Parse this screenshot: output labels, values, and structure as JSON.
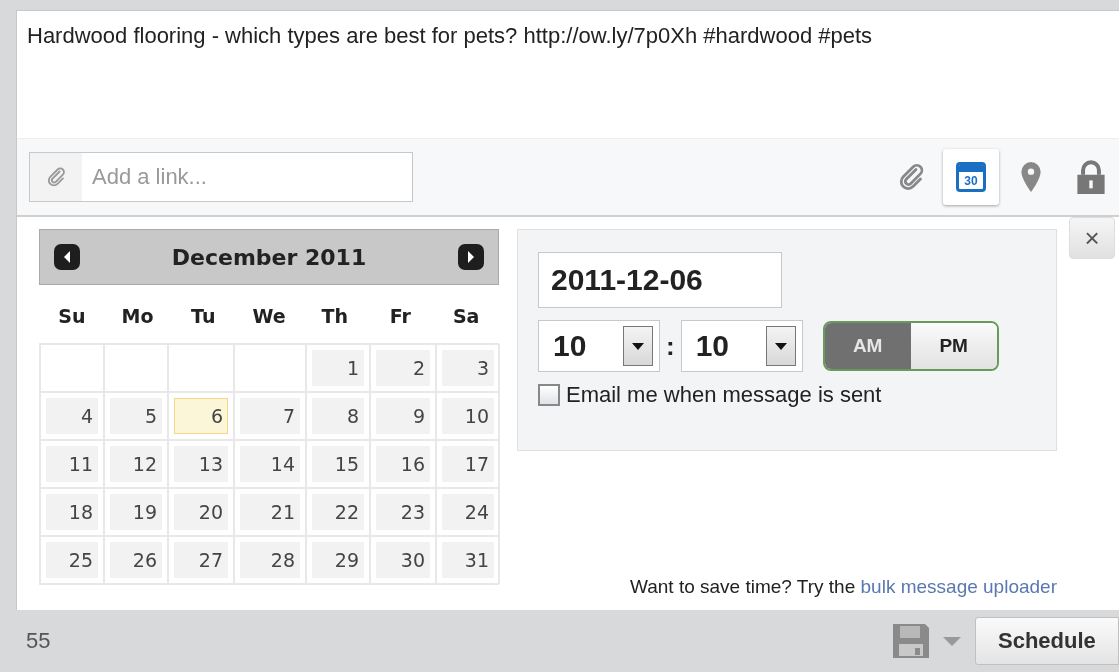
{
  "message": {
    "text": "Hardwood flooring - which types are best for pets? http://ow.ly/7p0Xh #hardwood #pets"
  },
  "link_field": {
    "placeholder": "Add a link..."
  },
  "tools": [
    {
      "kind": "attach",
      "selected": false
    },
    {
      "kind": "calendar",
      "selected": true,
      "label": "30"
    },
    {
      "kind": "location",
      "selected": false
    },
    {
      "kind": "lock",
      "selected": false
    }
  ],
  "calendar": {
    "title": "December 2011",
    "weekdays": [
      "Su",
      "Mo",
      "Tu",
      "We",
      "Th",
      "Fr",
      "Sa"
    ],
    "weeks": [
      {
        "days": [
          {
            "label": "1",
            "selected": false
          },
          {
            "label": "2",
            "selected": false
          },
          {
            "label": "3",
            "selected": false
          }
        ]
      },
      {
        "days": [
          {
            "label": "4",
            "selected": false
          },
          {
            "label": "5",
            "selected": false
          },
          {
            "label": "6",
            "selected": true
          },
          {
            "label": "7",
            "selected": false
          },
          {
            "label": "8",
            "selected": false
          },
          {
            "label": "9",
            "selected": false
          },
          {
            "label": "10",
            "selected": false
          }
        ]
      },
      {
        "days": [
          {
            "label": "11",
            "selected": false
          },
          {
            "label": "12",
            "selected": false
          },
          {
            "label": "13",
            "selected": false
          },
          {
            "label": "14",
            "selected": false
          },
          {
            "label": "15",
            "selected": false
          },
          {
            "label": "16",
            "selected": false
          },
          {
            "label": "17",
            "selected": false
          }
        ]
      },
      {
        "days": [
          {
            "label": "18",
            "selected": false
          },
          {
            "label": "19",
            "selected": false
          },
          {
            "label": "20",
            "selected": false
          },
          {
            "label": "21",
            "selected": false
          },
          {
            "label": "22",
            "selected": false
          },
          {
            "label": "23",
            "selected": false
          },
          {
            "label": "24",
            "selected": false
          }
        ]
      },
      {
        "days": [
          {
            "label": "25",
            "selected": false
          },
          {
            "label": "26",
            "selected": false
          },
          {
            "label": "27",
            "selected": false
          },
          {
            "label": "28",
            "selected": false
          },
          {
            "label": "29",
            "selected": false
          },
          {
            "label": "30",
            "selected": false
          },
          {
            "label": "31",
            "selected": false
          }
        ]
      }
    ]
  },
  "schedule": {
    "date": "2011-12-06",
    "hour": "10",
    "separator": ":",
    "minute": "10",
    "meridiem": [
      {
        "label": "AM",
        "selected": true
      },
      {
        "label": "PM",
        "selected": false
      }
    ],
    "email_option": {
      "label": "Email me when message is sent",
      "checked": false
    },
    "close": "×"
  },
  "bulk_hint": {
    "text": "Want to save time? Try the",
    "link": "bulk message uploader"
  },
  "footer": {
    "count": "55",
    "button": "Schedule"
  }
}
